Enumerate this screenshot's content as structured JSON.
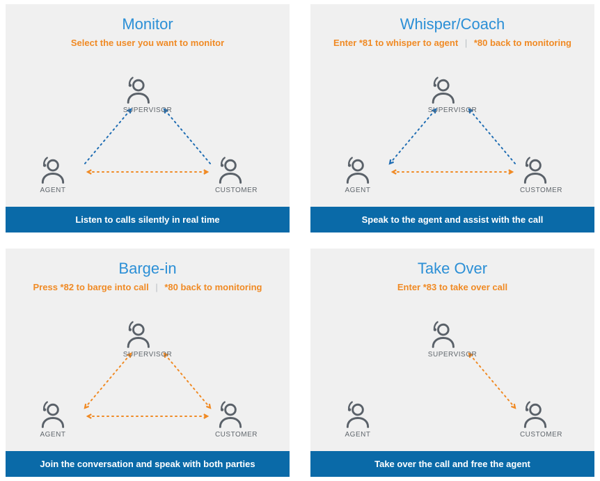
{
  "roles": {
    "supervisor": "SUPERVISOR",
    "agent": "AGENT",
    "customer": "CUSTOMER"
  },
  "colors": {
    "blue": "#1f6db3",
    "orange": "#f08a24",
    "icon": "#5a6169"
  },
  "cards": [
    {
      "title": "Monitor",
      "sub_a": "Select the user you want to monitor",
      "sub_b": "",
      "footer": "Listen to calls silently in real time",
      "arrows": {
        "sup_agent": {
          "color": "blue",
          "dir": "toSup"
        },
        "sup_cust": {
          "color": "blue",
          "dir": "toSup"
        },
        "agent_cust": {
          "color": "orange",
          "dir": "both"
        }
      }
    },
    {
      "title": "Whisper/Coach",
      "sub_a": "Enter *81 to whisper to agent",
      "sub_b": "*80 back to monitoring",
      "footer": "Speak to the agent and assist with the call",
      "arrows": {
        "sup_agent": {
          "color": "blue",
          "dir": "both"
        },
        "sup_cust": {
          "color": "blue",
          "dir": "toSup"
        },
        "agent_cust": {
          "color": "orange",
          "dir": "both"
        }
      }
    },
    {
      "title": "Barge-in",
      "sub_a": "Press *82 to barge into call",
      "sub_b": "*80 back to monitoring",
      "footer": "Join the conversation and speak with both parties",
      "arrows": {
        "sup_agent": {
          "color": "orange",
          "dir": "both"
        },
        "sup_cust": {
          "color": "orange",
          "dir": "both"
        },
        "agent_cust": {
          "color": "orange",
          "dir": "both"
        }
      }
    },
    {
      "title": "Take Over",
      "sub_a": "Enter *83 to take over call",
      "sub_b": "",
      "footer": "Take over the call and free the agent",
      "arrows": {
        "sup_agent": null,
        "sup_cust": {
          "color": "orange",
          "dir": "both"
        },
        "agent_cust": null
      }
    }
  ]
}
